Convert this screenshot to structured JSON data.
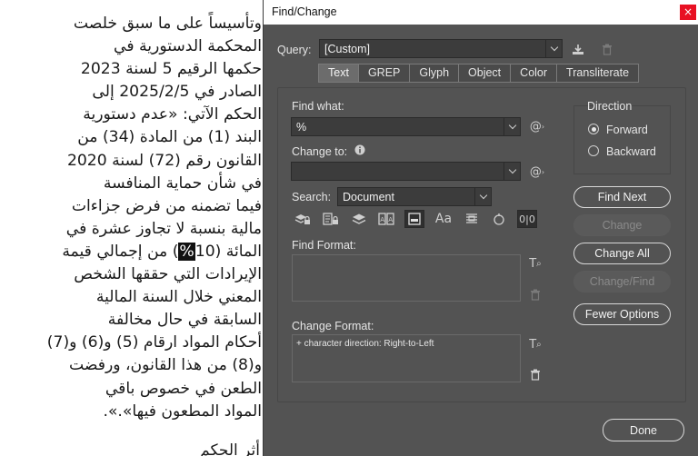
{
  "document": {
    "lines": [
      "وتأسيساً على ما سبق خلصت",
      "المحكمة الدستورية في",
      "حكمها الرقيم 5 لسنة 2023",
      "الصادر في 2025/2/5 إلى",
      "الحكم الآتي: «عدم دستورية",
      "البند (1) من المادة (34) من",
      "القانون رقم (72) لسنة 2020",
      "في شأن حماية المنافسة",
      "فيما تضمنه من فرض جزاءات",
      "مالية بنسبة لا تجاوز عشرة في"
    ],
    "line11_before": "المائة (10",
    "line11_highlight": "%",
    "line11_after": ") من إجمالي قيمة",
    "lines_after": [
      "الإيرادات التي حققها الشخص",
      "المعني خلال السنة المالية",
      "السابقة في حال مخالفة",
      "أحكام المواد ارقام (5) و(6) و(7)",
      "و(8) من هذا القانون، ورفضت",
      "الطعن في خصوص باقي",
      "المواد المطعون فيها».»."
    ],
    "next_heading": "أثر الحكم"
  },
  "dialog": {
    "title": "Find/Change",
    "close_glyph": "×",
    "query_label": "Query:",
    "query_value": "[Custom]",
    "tabs": [
      "Text",
      "GREP",
      "Glyph",
      "Object",
      "Color",
      "Transliterate"
    ],
    "active_tab": "Text",
    "find_what_label": "Find what:",
    "find_what_value": "%",
    "change_to_label": "Change to:",
    "change_to_value": "",
    "search_label": "Search:",
    "search_value": "Document",
    "direction_label": "Direction",
    "direction_forward": "Forward",
    "direction_backward": "Backward",
    "find_format_label": "Find Format:",
    "find_format_value": "",
    "change_format_label": "Change Format:",
    "change_format_value": "+ character direction: Right-to-Left",
    "buttons": {
      "find_next": "Find Next",
      "change": "Change",
      "change_all": "Change All",
      "change_find": "Change/Find",
      "fewer_options": "Fewer Options",
      "done": "Done"
    }
  }
}
